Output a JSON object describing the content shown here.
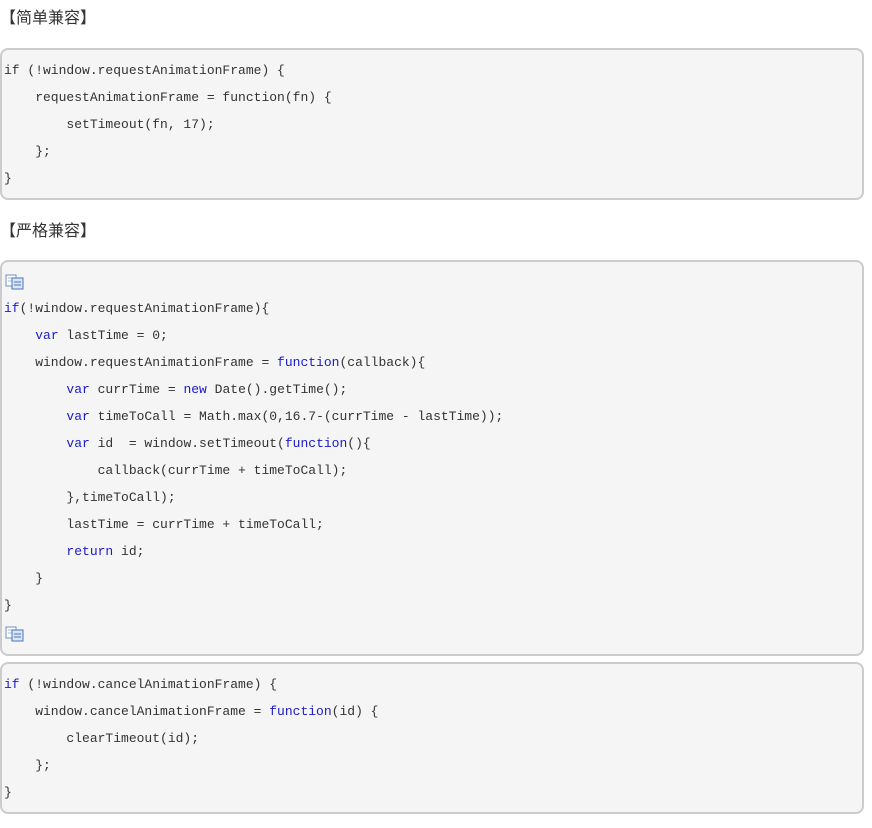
{
  "headings": {
    "simple": "【简单兼容】",
    "strict": "【严格兼容】"
  },
  "icons": {
    "copy_icon": "copy-code-icon"
  },
  "colors": {
    "code_background": "#f5f5f5",
    "code_border": "#cccccc",
    "keyword": "#1a1ac8",
    "text": "#333333"
  },
  "code_blocks": [
    {
      "lines": [
        [
          {
            "t": "if (!window.requestAnimationFrame) {"
          }
        ],
        [
          {
            "t": "    requestAnimationFrame = function(fn) {"
          }
        ],
        [
          {
            "t": "        setTimeout(fn, 17);"
          }
        ],
        [
          {
            "t": "    };"
          }
        ],
        [
          {
            "t": "}"
          }
        ]
      ]
    },
    {
      "lines": [
        [
          {
            "t": "if",
            "k": true
          },
          {
            "t": "(!window.requestAnimationFrame){"
          }
        ],
        [
          {
            "t": "    "
          },
          {
            "t": "var",
            "k": true
          },
          {
            "t": " lastTime = 0;"
          }
        ],
        [
          {
            "t": "    window.requestAnimationFrame = "
          },
          {
            "t": "function",
            "k": true
          },
          {
            "t": "(callback){"
          }
        ],
        [
          {
            "t": "        "
          },
          {
            "t": "var",
            "k": true
          },
          {
            "t": " currTime = "
          },
          {
            "t": "new",
            "k": true
          },
          {
            "t": " Date().getTime();"
          }
        ],
        [
          {
            "t": "        "
          },
          {
            "t": "var",
            "k": true
          },
          {
            "t": " timeToCall = Math.max(0,16.7-(currTime - lastTime));"
          }
        ],
        [
          {
            "t": "        "
          },
          {
            "t": "var",
            "k": true
          },
          {
            "t": " id  = window.setTimeout("
          },
          {
            "t": "function",
            "k": true
          },
          {
            "t": "(){"
          }
        ],
        [
          {
            "t": "            callback(currTime + timeToCall);"
          }
        ],
        [
          {
            "t": "        },timeToCall);"
          }
        ],
        [
          {
            "t": "        lastTime = currTime + timeToCall;"
          }
        ],
        [
          {
            "t": "        "
          },
          {
            "t": "return",
            "k": true
          },
          {
            "t": " id;"
          }
        ],
        [
          {
            "t": "    }"
          }
        ],
        [
          {
            "t": "}"
          }
        ]
      ]
    },
    {
      "lines": [
        [
          {
            "t": "if",
            "k": true
          },
          {
            "t": " (!window.cancelAnimationFrame) {"
          }
        ],
        [
          {
            "t": "    window.cancelAnimationFrame = "
          },
          {
            "t": "function",
            "k": true
          },
          {
            "t": "(id) {"
          }
        ],
        [
          {
            "t": "        clearTimeout(id);"
          }
        ],
        [
          {
            "t": "    };"
          }
        ],
        [
          {
            "t": "}"
          }
        ]
      ]
    }
  ]
}
